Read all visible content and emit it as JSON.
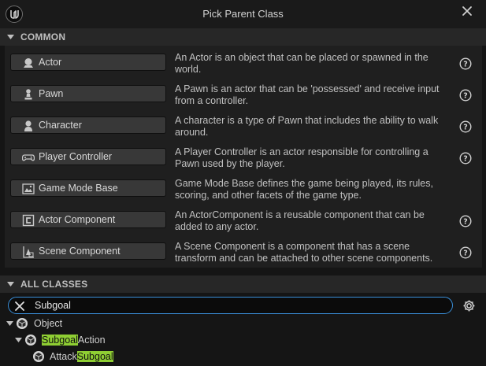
{
  "window": {
    "title": "Pick Parent Class",
    "icons": {
      "logo": "unreal-logo-icon",
      "close": "close-icon"
    }
  },
  "common_section": {
    "header": "COMMON",
    "items": [
      {
        "label": "Actor",
        "icon": "actor-icon",
        "description": "An Actor is an object that can be placed or spawned in the world.",
        "help": true
      },
      {
        "label": "Pawn",
        "icon": "pawn-icon",
        "description": "A Pawn is an actor that can be 'possessed' and receive input from a controller.",
        "help": true
      },
      {
        "label": "Character",
        "icon": "character-icon",
        "description": "A character is a type of Pawn that includes the ability to walk around.",
        "help": true
      },
      {
        "label": "Player Controller",
        "icon": "gamepad-icon",
        "description": "A Player Controller is an actor responsible for controlling a Pawn used by the player.",
        "help": true
      },
      {
        "label": "Game Mode Base",
        "icon": "game-mode-icon",
        "description": "Game Mode Base defines the game being played, its rules, scoring, and other facets of the game type.",
        "help": false
      },
      {
        "label": "Actor Component",
        "icon": "actor-component-icon",
        "description": "An ActorComponent is a reusable component that can be added to any actor.",
        "help": true
      },
      {
        "label": "Scene Component",
        "icon": "scene-component-icon",
        "description": "A Scene Component is a component that has a scene transform and can be attached to other scene components.",
        "help": true
      }
    ]
  },
  "all_classes_section": {
    "header": "ALL CLASSES",
    "search": {
      "value": "Subgoal",
      "placeholder": ""
    },
    "tree": [
      {
        "prefix": "Object",
        "match": "",
        "suffix": "",
        "expanded": true
      },
      {
        "prefix": "",
        "match": "Subgoal",
        "suffix": "Action",
        "expanded": true
      },
      {
        "prefix": "Attack",
        "match": "Subgoal",
        "suffix": "",
        "expanded": false
      }
    ]
  },
  "colors": {
    "highlight": "#8fce33",
    "search_border": "#3a8fd9",
    "background": "#151515"
  }
}
